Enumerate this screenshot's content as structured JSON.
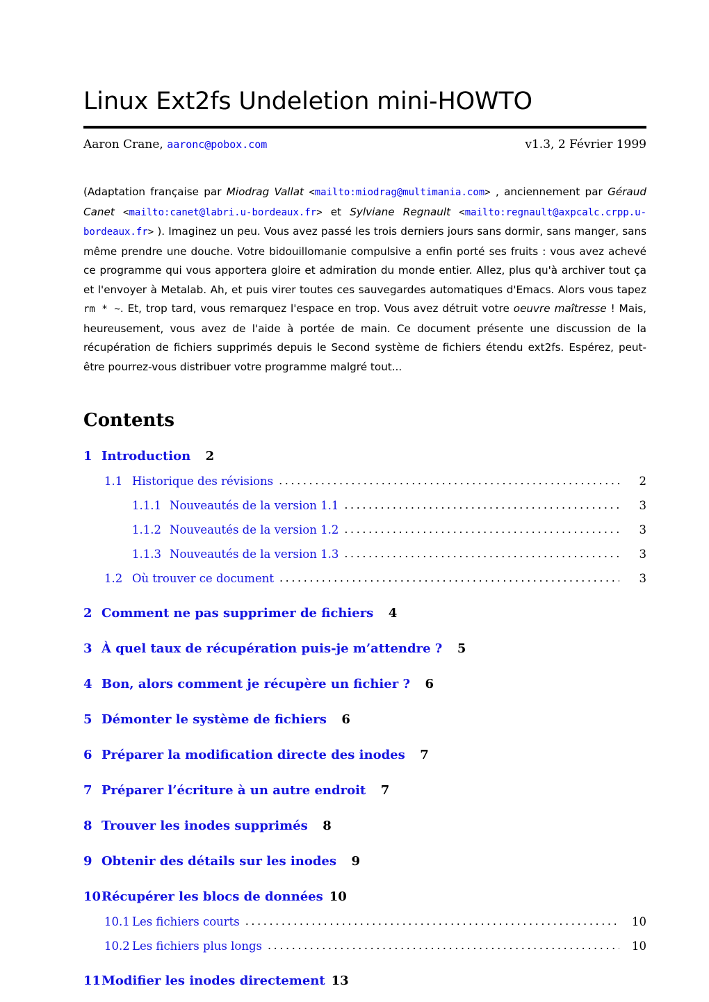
{
  "document": {
    "title": "Linux Ext2fs Undeletion mini-HOWTO",
    "author_name": "Aaron Crane, ",
    "author_email": "aaronc@pobox.com",
    "version_date": "v1.3, 2 Février 1999"
  },
  "abstract": {
    "p1_open": "(Adaptation française par ",
    "translator1": "Miodrag Vallat",
    "bracket_open": "<",
    "link1": "mailto:miodrag@multimania.com",
    "bracket_close": ">",
    "p2": " , anciennement par ",
    "translator2": "Géraud Canet",
    "link2": "mailto:canet@labri.u-bordeaux.fr",
    "p3": " et ",
    "translator3": "Sylviane Regnault",
    "link3": "mailto:regnault@axpcalc.crpp.u-bordeaux.fr",
    "p4": " ). Imaginez un peu. Vous avez passé les trois derniers jours sans dormir, sans manger, sans même prendre une douche. Votre bidouillomanie compulsive a enfin porté ses fruits : vous avez achevé ce programme qui vous apportera gloire et admiration du monde entier. Allez, plus qu'à archiver tout ça et l'envoyer à Metalab. Ah, et puis virer toutes ces sauvegardes automatiques d'Emacs. Alors vous tapez ",
    "command": "rm * ~",
    "p5": ". Et, trop tard, vous remarquez l'espace en trop. Vous avez détruit votre ",
    "emphasis": "oeuvre maîtresse",
    "p6": " ! Mais, heureusement, vous avez de l'aide à portée de main. Ce document présente une discussion de la récupération de fichiers supprimés depuis le Second système de fichiers étendu ext2fs. Espérez, peut-être pourrez-vous distribuer votre programme malgré tout..."
  },
  "contents": {
    "heading": "Contents",
    "entries": [
      {
        "level": 1,
        "number": "1",
        "label": "Introduction",
        "page": "2"
      },
      {
        "level": 2,
        "number": "1.1",
        "label": "Historique des révisions",
        "page": "2"
      },
      {
        "level": 3,
        "number": "1.1.1",
        "label": "Nouveautés de la version 1.1",
        "page": "3"
      },
      {
        "level": 3,
        "number": "1.1.2",
        "label": "Nouveautés de la version 1.2",
        "page": "3"
      },
      {
        "level": 3,
        "number": "1.1.3",
        "label": "Nouveautés de la version 1.3",
        "page": "3"
      },
      {
        "level": 2,
        "number": "1.2",
        "label": "Où trouver ce document",
        "page": "3"
      },
      {
        "level": 1,
        "number": "2",
        "label": "Comment ne pas supprimer de fichiers",
        "page": "4"
      },
      {
        "level": 1,
        "number": "3",
        "label": "À quel taux de récupération puis-je m’attendre ?",
        "page": "5"
      },
      {
        "level": 1,
        "number": "4",
        "label": "Bon, alors comment je récupère un fichier ?",
        "page": "6"
      },
      {
        "level": 1,
        "number": "5",
        "label": "Démonter le système de fichiers",
        "page": "6"
      },
      {
        "level": 1,
        "number": "6",
        "label": "Préparer la modification directe des inodes",
        "page": "7"
      },
      {
        "level": 1,
        "number": "7",
        "label": "Préparer l’écriture à un autre endroit",
        "page": "7"
      },
      {
        "level": 1,
        "number": "8",
        "label": "Trouver les inodes supprimés",
        "page": "8"
      },
      {
        "level": 1,
        "number": "9",
        "label": "Obtenir des détails sur les inodes",
        "page": "9"
      },
      {
        "level": 1,
        "number": "10",
        "label": "Récupérer les blocs de données",
        "page": "10"
      },
      {
        "level": 2,
        "number": "10.1",
        "label": "Les fichiers courts",
        "page": "10"
      },
      {
        "level": 2,
        "number": "10.2",
        "label": "Les fichiers plus longs",
        "page": "10"
      },
      {
        "level": 1,
        "number": "11",
        "label": "Modifier les inodes directement",
        "page": "13"
      }
    ]
  },
  "colors": {
    "link": "#0000e8",
    "toc_link": "#1414e0",
    "text": "#000000",
    "background": "#ffffff"
  }
}
